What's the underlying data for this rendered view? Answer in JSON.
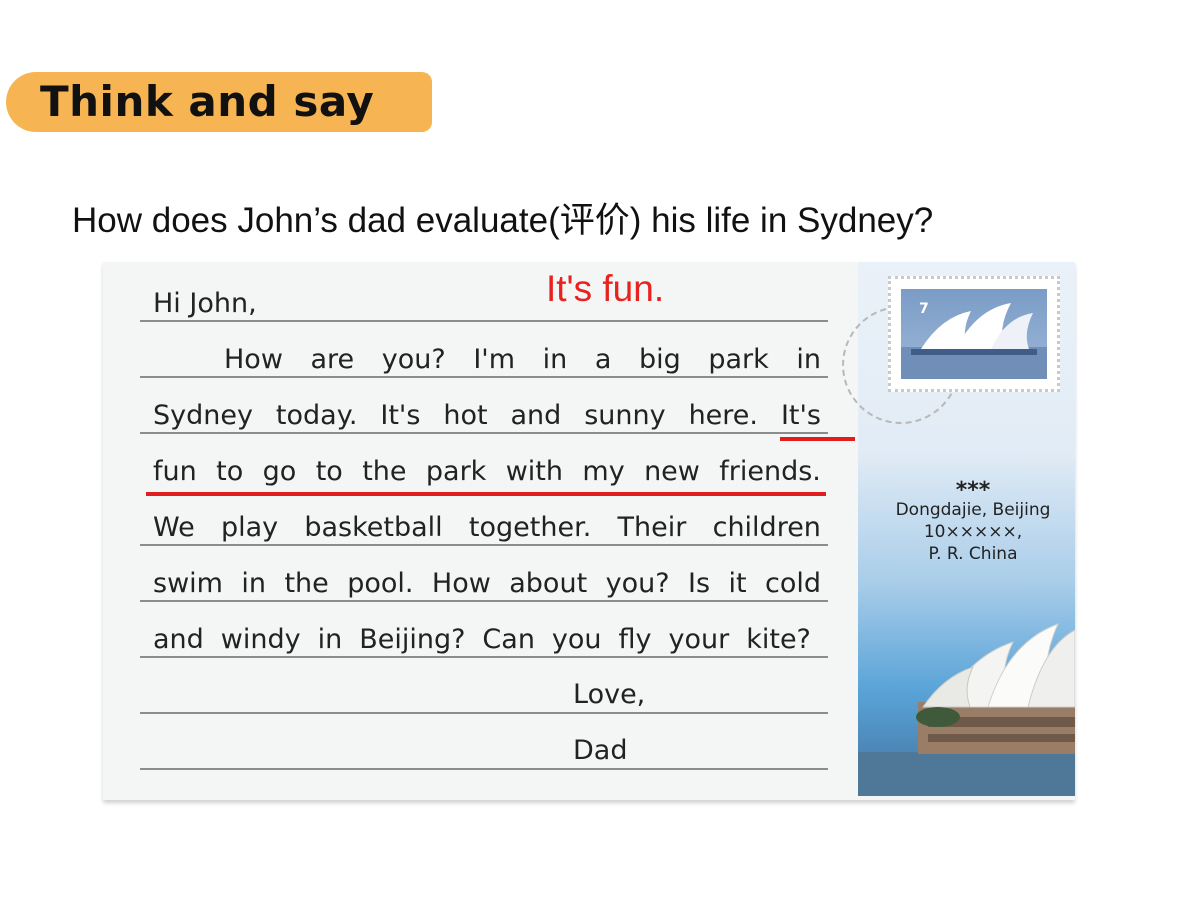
{
  "header": {
    "badge_label": "Think and say"
  },
  "question": "How does John’s dad evaluate(评价) his life in Sydney?",
  "answer": "It's fun.",
  "postcard": {
    "greeting": "Hi John,",
    "lines": [
      [
        "How",
        "are",
        "you?",
        "I'm",
        "in",
        "a",
        "big",
        "park",
        "in"
      ],
      [
        "Sydney",
        "today.",
        "It's",
        "hot",
        "and",
        "sunny",
        "here.",
        "It's"
      ],
      [
        "fun",
        "to",
        "go",
        "to",
        "the",
        "park",
        "with",
        "my",
        "new",
        "friends."
      ],
      [
        "We",
        "play",
        "basketball",
        "together.",
        "Their",
        "children"
      ],
      [
        "swim",
        "in",
        "the",
        "pool.",
        "How",
        "about",
        "you?",
        "Is",
        "it",
        "cold"
      ],
      [
        "and",
        "windy",
        "in",
        "Beijing?",
        "Can",
        "you",
        "fly",
        "your",
        "kite?"
      ]
    ],
    "closing": "Love,",
    "signature": "Dad",
    "stamp_number": "7",
    "address": {
      "name": "***",
      "street": "Dongdajie, Beijing",
      "postcode": "10×××××,",
      "country": "P. R. China"
    }
  },
  "colors": {
    "badge": "#f7b452",
    "answer": "#e8221e",
    "underline": "#e01e1e"
  }
}
